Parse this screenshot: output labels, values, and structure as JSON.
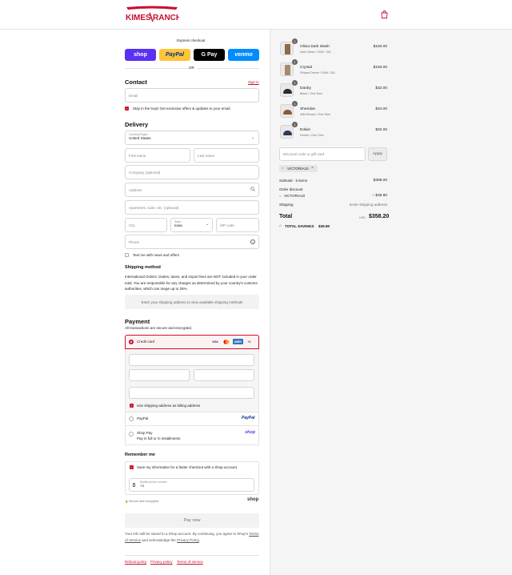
{
  "brand": {
    "logo_text_left": "KIMES",
    "logo_text_right": "RANCH",
    "accent": "#c8102e"
  },
  "express": {
    "label": "Express checkout",
    "or": "OR",
    "buttons": [
      {
        "label": "shop",
        "color": "#5a31f4"
      },
      {
        "label": "PayPal",
        "color": "#ffc439"
      },
      {
        "label": "G Pay",
        "color": "#000000"
      },
      {
        "label": "venmo",
        "color": "#008cff"
      }
    ]
  },
  "contact": {
    "title": "Contact",
    "signin": "Sign in",
    "email_placeholder": "Email",
    "offers": "Stay in the loop! Get exclusive offers & updates to your email."
  },
  "delivery": {
    "title": "Delivery",
    "country_label": "Country/Region",
    "country_value": "United States",
    "first_name": "First name",
    "last_name": "Last name",
    "company": "Company (optional)",
    "address": "Address",
    "apartment": "Apartment, suite, etc. (optional)",
    "city": "City",
    "state_label": "State",
    "state_value": "Iowa",
    "zip": "ZIP code",
    "phone": "Phone",
    "text_me": "Text me with news and offers"
  },
  "shipping": {
    "title": "Shipping method",
    "notice": "International Orders: Duties, taxes, and import fees are NOT included in your order total. You are responsible for any charges as determined by your country's customs authorities, which can range up to 25%.",
    "placeholder": "Enter your shipping address to view available shipping methods"
  },
  "payment": {
    "title": "Payment",
    "subtitle": "All transactions are secure and encrypted.",
    "credit_card": "Credit card",
    "card_logos": [
      "VISA",
      "MC",
      "AMEX",
      "+3"
    ],
    "billing_same": "Use shipping address as billing address",
    "paypal": "PayPal",
    "paypal_logo": "PayPal",
    "shop_pay": "Shop Pay",
    "shop_pay_sub": "Pay in full or in installments",
    "shop_logo": "shop"
  },
  "remember": {
    "title": "Remember me",
    "save_info": "Save my information for a faster checkout with a Shop account",
    "phone_label": "Mobile phone number",
    "phone_value": "+1",
    "secure": "Secure and encrypted",
    "shop_logo": "shop"
  },
  "pay_now": "Pay now",
  "legal": {
    "text_1": "Your info will be saved to a Shop account. By continuing, you agree to Shop's",
    "terms": "Terms of Service",
    "text_2": "and acknowledge the",
    "privacy": "Privacy Policy",
    "period": "."
  },
  "footer": {
    "refund": "Refund policy",
    "privacy": "Privacy policy",
    "terms": "Terms of service"
  },
  "cart": {
    "items": [
      {
        "qty": "1",
        "name": "Olivia Dark Wash",
        "variant": "Dark Wash / 00W / 30L",
        "price": "$150.00",
        "thumb_color": "#8b6b4a"
      },
      {
        "qty": "1",
        "name": "Crystal",
        "variant": "Striped Denim / 00W / 30L",
        "price": "$150.00",
        "thumb_color": "#a78a6d"
      },
      {
        "qty": "1",
        "name": "Danby",
        "variant": "Black / One Size",
        "price": "$32.00",
        "thumb_color": "#2b2b2b"
      },
      {
        "qty": "1",
        "name": "Sheridan",
        "variant": "Wild Brown / One Size",
        "price": "$34.00",
        "thumb_color": "#8a5a3a"
      },
      {
        "qty": "1",
        "name": "Edwin",
        "variant": "Denim / One Size",
        "price": "$32.00",
        "thumb_color": "#2e3b55"
      }
    ],
    "discount_placeholder": "Discount code or gift card",
    "apply": "Apply",
    "code_tag": "VICTORIA10",
    "subtotal_label": "Subtotal · 5 items",
    "subtotal_value": "$398.00",
    "order_discount_label": "Order discount",
    "discount_code": "VICTORIA10",
    "discount_value": "– $39.80",
    "shipping_label": "Shipping",
    "shipping_value": "Enter shipping address",
    "total_label": "Total",
    "currency": "USD",
    "total_value": "$358.20",
    "savings_label": "TOTAL SAVINGS",
    "savings_value": "$39.80"
  }
}
